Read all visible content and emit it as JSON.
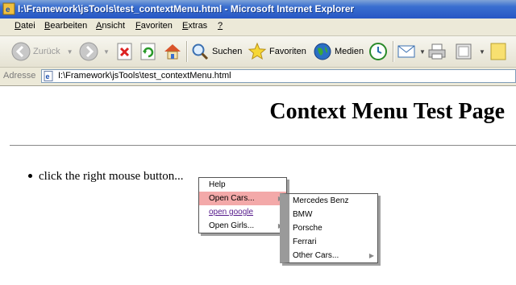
{
  "window": {
    "title": "I:\\Framework\\jsTools\\test_contextMenu.html - Microsoft Internet Explorer"
  },
  "menubar": {
    "items": [
      {
        "label": "Datei",
        "accel": "D",
        "rest": "atei"
      },
      {
        "label": "Bearbeiten",
        "accel": "B",
        "rest": "earbeiten"
      },
      {
        "label": "Ansicht",
        "accel": "A",
        "rest": "nsicht"
      },
      {
        "label": "Favoriten",
        "accel": "F",
        "rest": "avoriten"
      },
      {
        "label": "Extras",
        "accel": "E",
        "rest": "xtras"
      },
      {
        "label": "?",
        "accel": "?",
        "rest": ""
      }
    ]
  },
  "toolbar": {
    "back_label": "Zurück",
    "search_label": "Suchen",
    "favorites_label": "Favoriten",
    "media_label": "Medien"
  },
  "address": {
    "label": "Adresse",
    "value": "I:\\Framework\\jsTools\\test_contextMenu.html"
  },
  "page": {
    "heading": "Context Menu Test Page",
    "bullet": "click the right mouse button..."
  },
  "context_menu": {
    "items": [
      {
        "label": "Help",
        "submenu": false,
        "highlighted": false,
        "link": false
      },
      {
        "label": "Open Cars...",
        "submenu": true,
        "highlighted": true,
        "link": false
      },
      {
        "label": "open google",
        "submenu": false,
        "highlighted": false,
        "link": true
      },
      {
        "label": "Open Girls...",
        "submenu": true,
        "highlighted": false,
        "link": false
      }
    ]
  },
  "cars_submenu": {
    "items": [
      {
        "label": "Mercedes Benz",
        "submenu": false
      },
      {
        "label": "BMW",
        "submenu": false
      },
      {
        "label": "Porsche",
        "submenu": false
      },
      {
        "label": "Ferrari",
        "submenu": false
      },
      {
        "label": "Other Cars...",
        "submenu": true
      }
    ]
  },
  "colors": {
    "titlebar": "#2757c4",
    "highlight": "#f3a9a9",
    "submenu_strip": "#9a9a9a"
  }
}
